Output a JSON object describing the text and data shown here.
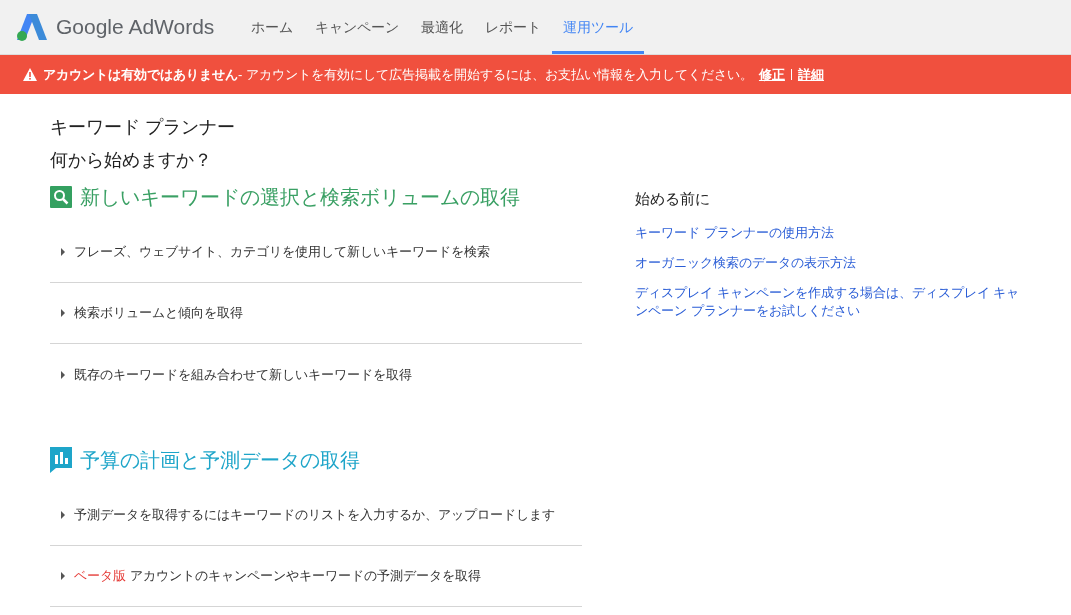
{
  "header": {
    "logo_text": "Google AdWords",
    "nav": [
      {
        "label": "ホーム",
        "selected": false
      },
      {
        "label": "キャンペーン",
        "selected": false
      },
      {
        "label": "最適化",
        "selected": false
      },
      {
        "label": "レポート",
        "selected": false
      },
      {
        "label": "運用ツール",
        "selected": true
      }
    ]
  },
  "alert": {
    "title": "アカウントは有効ではありません",
    "message": " - アカウントを有効にして広告掲載を開始するには、お支払い情報を入力してください。",
    "links": [
      "修正",
      "詳細"
    ]
  },
  "page_title": "キーワード プランナー",
  "subtitle": "何から始めますか？",
  "sections": [
    {
      "kind": "search",
      "title": "新しいキーワードの選択と検索ボリュームの取得",
      "items": [
        {
          "text": "フレーズ、ウェブサイト、カテゴリを使用して新しいキーワードを検索"
        },
        {
          "text": "検索ボリュームと傾向を取得"
        },
        {
          "text": "既存のキーワードを組み合わせて新しいキーワードを取得"
        }
      ]
    },
    {
      "kind": "chart",
      "title": "予算の計画と予測データの取得",
      "items": [
        {
          "text": "予測データを取得するにはキーワードのリストを入力するか、アップロードします"
        },
        {
          "badge": "ベータ版",
          "text": "アカウントのキャンペーンやキーワードの予測データを取得"
        }
      ]
    }
  ],
  "sidebar": {
    "title": "始める前に",
    "links": [
      "キーワード プランナーの使用方法",
      "オーガニック検索のデータの表示方法",
      "ディスプレイ キャンペーンを作成する場合は、ディスプレイ キャンペーン プランナーをお試しください"
    ]
  }
}
